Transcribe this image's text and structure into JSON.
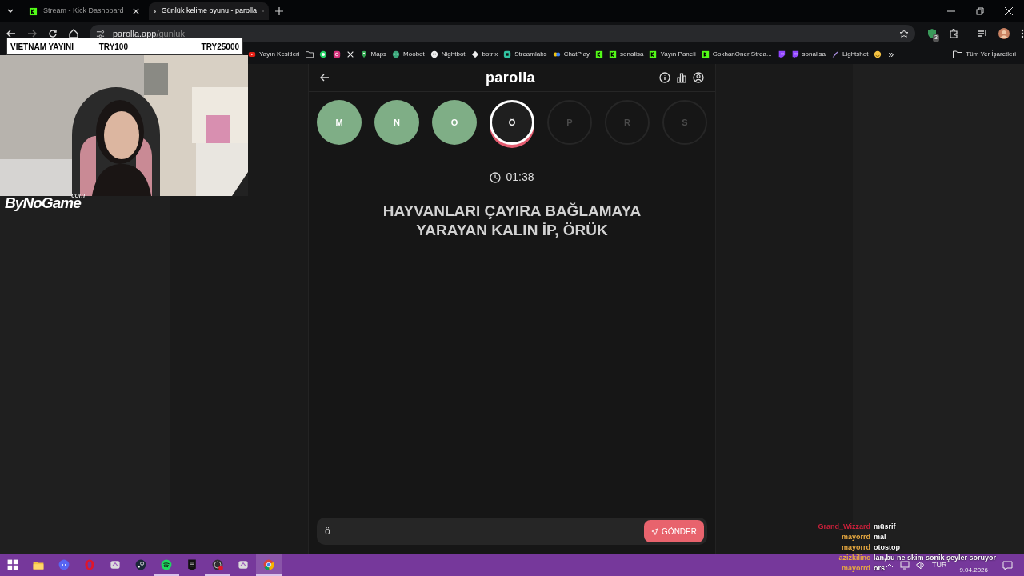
{
  "browser": {
    "tabs": [
      {
        "title": "Stream - Kick Dashboard",
        "kind": "kick",
        "selected": false
      },
      {
        "title": "Günlük kelime oyunu - parolla",
        "kind": "parolla",
        "selected": true
      }
    ],
    "address": {
      "host": "parolla.app",
      "path": "/gunluk"
    },
    "bookmarks": [
      {
        "label": "Yayın Kesitleri",
        "kind": "youtube"
      },
      {
        "kind": "folder"
      },
      {
        "kind": "whatsapp"
      },
      {
        "kind": "instagram"
      },
      {
        "kind": "x"
      },
      {
        "label": "Maps",
        "kind": "pin"
      },
      {
        "label": "Moobot",
        "kind": "moobot"
      },
      {
        "label": "Nightbot",
        "kind": "nightbot"
      },
      {
        "label": "botrix",
        "kind": "botrix"
      },
      {
        "label": "Streamlabs",
        "kind": "streamlabs"
      },
      {
        "label": "ChatPlay",
        "kind": "chatplay"
      },
      {
        "kind": "kick"
      },
      {
        "label": "sonalisa",
        "kind": "kick"
      },
      {
        "label": "Yayın Paneli",
        "kind": "kick"
      },
      {
        "label": "GokhanOner Strea...",
        "kind": "kick"
      },
      {
        "kind": "twitch"
      },
      {
        "label": "sonalisa",
        "kind": "twitch"
      },
      {
        "label": "Lightshot",
        "kind": "feather"
      },
      {
        "kind": "emoji"
      }
    ],
    "more": "»",
    "all_bookmarks": "Tüm Yer İşaretleri",
    "extension_count": "3"
  },
  "stream_overlay": {
    "banner": [
      "VIETNAM YAYINI",
      "TRY100",
      "TRY25000"
    ],
    "logo": "ByNoGame",
    "logo_suffix": ".com",
    "chat": [
      {
        "user": "Grand_Wizzard",
        "color": "#c8203a",
        "text": "müsrif"
      },
      {
        "user": "mayorrd",
        "color": "#e8a940",
        "text": "mal"
      },
      {
        "user": "mayorrd",
        "color": "#e8a940",
        "text": "otostop"
      },
      {
        "user": "azizkilinc",
        "color": "#e8a940",
        "text": "lan,bu ne skim sonik şeyler soruyor"
      },
      {
        "user": "mayorrd",
        "color": "#e8a940",
        "text": "örs"
      }
    ]
  },
  "app": {
    "title": "parolla",
    "letters": [
      {
        "letter": "M",
        "done": true,
        "selected": false
      },
      {
        "letter": "N",
        "done": true,
        "selected": false
      },
      {
        "letter": "O",
        "done": true,
        "selected": false
      },
      {
        "letter": "Ö",
        "done": false,
        "selected": true
      },
      {
        "letter": "P",
        "done": false,
        "selected": false
      },
      {
        "letter": "R",
        "done": false,
        "selected": false
      },
      {
        "letter": "S",
        "done": false,
        "selected": false
      }
    ],
    "timer": "01:38",
    "question": "HAYVANLARI ÇAYIRA BAĞLAMAYA YARAYAN KALIN İP, ÖRÜK",
    "answer": {
      "value": "ö"
    },
    "submit": "GÖNDER"
  },
  "taskbar": {
    "apps": [
      {
        "kind": "windows",
        "running": false,
        "selected": false
      },
      {
        "kind": "folder",
        "running": false,
        "selected": false
      },
      {
        "kind": "discord",
        "running": false,
        "selected": false
      },
      {
        "kind": "opera",
        "running": false,
        "selected": false
      },
      {
        "kind": "tool",
        "running": false,
        "selected": false
      },
      {
        "kind": "steam",
        "running": false,
        "selected": false
      },
      {
        "kind": "spotify",
        "running": true,
        "selected": false
      },
      {
        "kind": "epic",
        "running": false,
        "selected": false
      },
      {
        "kind": "obs",
        "running": true,
        "selected": false
      },
      {
        "kind": "tool",
        "running": false,
        "selected": false
      },
      {
        "kind": "chrome",
        "running": true,
        "selected": true
      }
    ],
    "language": "TUR",
    "date": "9.04.2026"
  }
}
